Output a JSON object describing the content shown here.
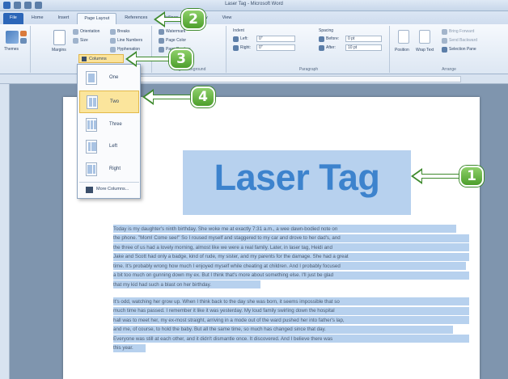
{
  "window": {
    "title": "Laser Tag - Microsoft Word"
  },
  "ribbon": {
    "tabs": [
      {
        "label": "File"
      },
      {
        "label": "Home"
      },
      {
        "label": "Insert"
      },
      {
        "label": "Page Layout"
      },
      {
        "label": "References"
      },
      {
        "label": "Mailings"
      },
      {
        "label": "Review"
      },
      {
        "label": "View"
      }
    ],
    "active_tab": "Page Layout",
    "page_setup": {
      "themes_label": "Themes",
      "margins_label": "Margins",
      "orientation_label": "Orientation",
      "size_label": "Size",
      "columns_label": "Columns",
      "breaks_label": "Breaks",
      "line_numbers_label": "Line Numbers",
      "hyphenation_label": "Hyphenation"
    },
    "page_background": {
      "watermark_label": "Watermark",
      "page_color_label": "Page Color",
      "page_borders_label": "Page Borders",
      "group_label": "Page Background"
    },
    "paragraph": {
      "indent_label": "Indent",
      "spacing_label": "Spacing",
      "left_label": "Left:",
      "left_value": "0\"",
      "right_label": "Right:",
      "right_value": "0\"",
      "before_label": "Before:",
      "before_value": "0 pt",
      "after_label": "After:",
      "after_value": "10 pt",
      "group_label": "Paragraph"
    },
    "arrange": {
      "position_label": "Position",
      "wrap_text_label": "Wrap Text",
      "bring_forward_label": "Bring Forward",
      "send_backward_label": "Send Backward",
      "selection_pane_label": "Selection Pane",
      "group_label": "Arrange"
    }
  },
  "columns_menu": {
    "items": [
      {
        "label": "One"
      },
      {
        "label": "Two"
      },
      {
        "label": "Three"
      },
      {
        "label": "Left"
      },
      {
        "label": "Right"
      }
    ],
    "hovered": "Two",
    "more_label": "More Columns..."
  },
  "document": {
    "title": "Laser Tag",
    "paragraph1": [
      "Today is my daughter's ninth birthday. She woke me at exactly 7:31 a.m., a wee dawn-bodied note on",
      "the phone. \"Mom! Come see!\" So I roused myself and staggered to my car and drove to her dad's, and",
      "the three of us had a lovely morning, almost like we were a real family. Later, in laser tag, Heidi and",
      "Jake and Scott had only a badge, kind of rude, my sister, and my parents for the damage. She had a great",
      "time. It's probably wrong how much I enjoyed myself while cheating at children. And I probably focused",
      "a bit too much on gunning down my ex. But I think that's more about something else. I'll just be glad",
      "that my kid had such a blast on her birthday."
    ],
    "paragraph2": [
      "It's odd, watching her grow up. When I think back to the day she was born, it seems impossible that so",
      "much time has passed. I remember it like it was yesterday. My loud family swirling down the hospital",
      "hall was to meet her, my ex-most straight, arriving in a mode out of the ward pushed her into father's lap,",
      "and me, of course, to hold the baby. But all the same time, so much has changed since that day.",
      "Everyone was still at each other, and it didn't dismantle once. It discovered. And I believe there was",
      "this year."
    ]
  },
  "callouts": [
    "1",
    "2",
    "3",
    "4"
  ],
  "colors": {
    "accent": "#3d83cd",
    "selection": "#b7d1ee",
    "callout_green": "#4d9f2c",
    "hover_yellow": "#fbe59c"
  }
}
